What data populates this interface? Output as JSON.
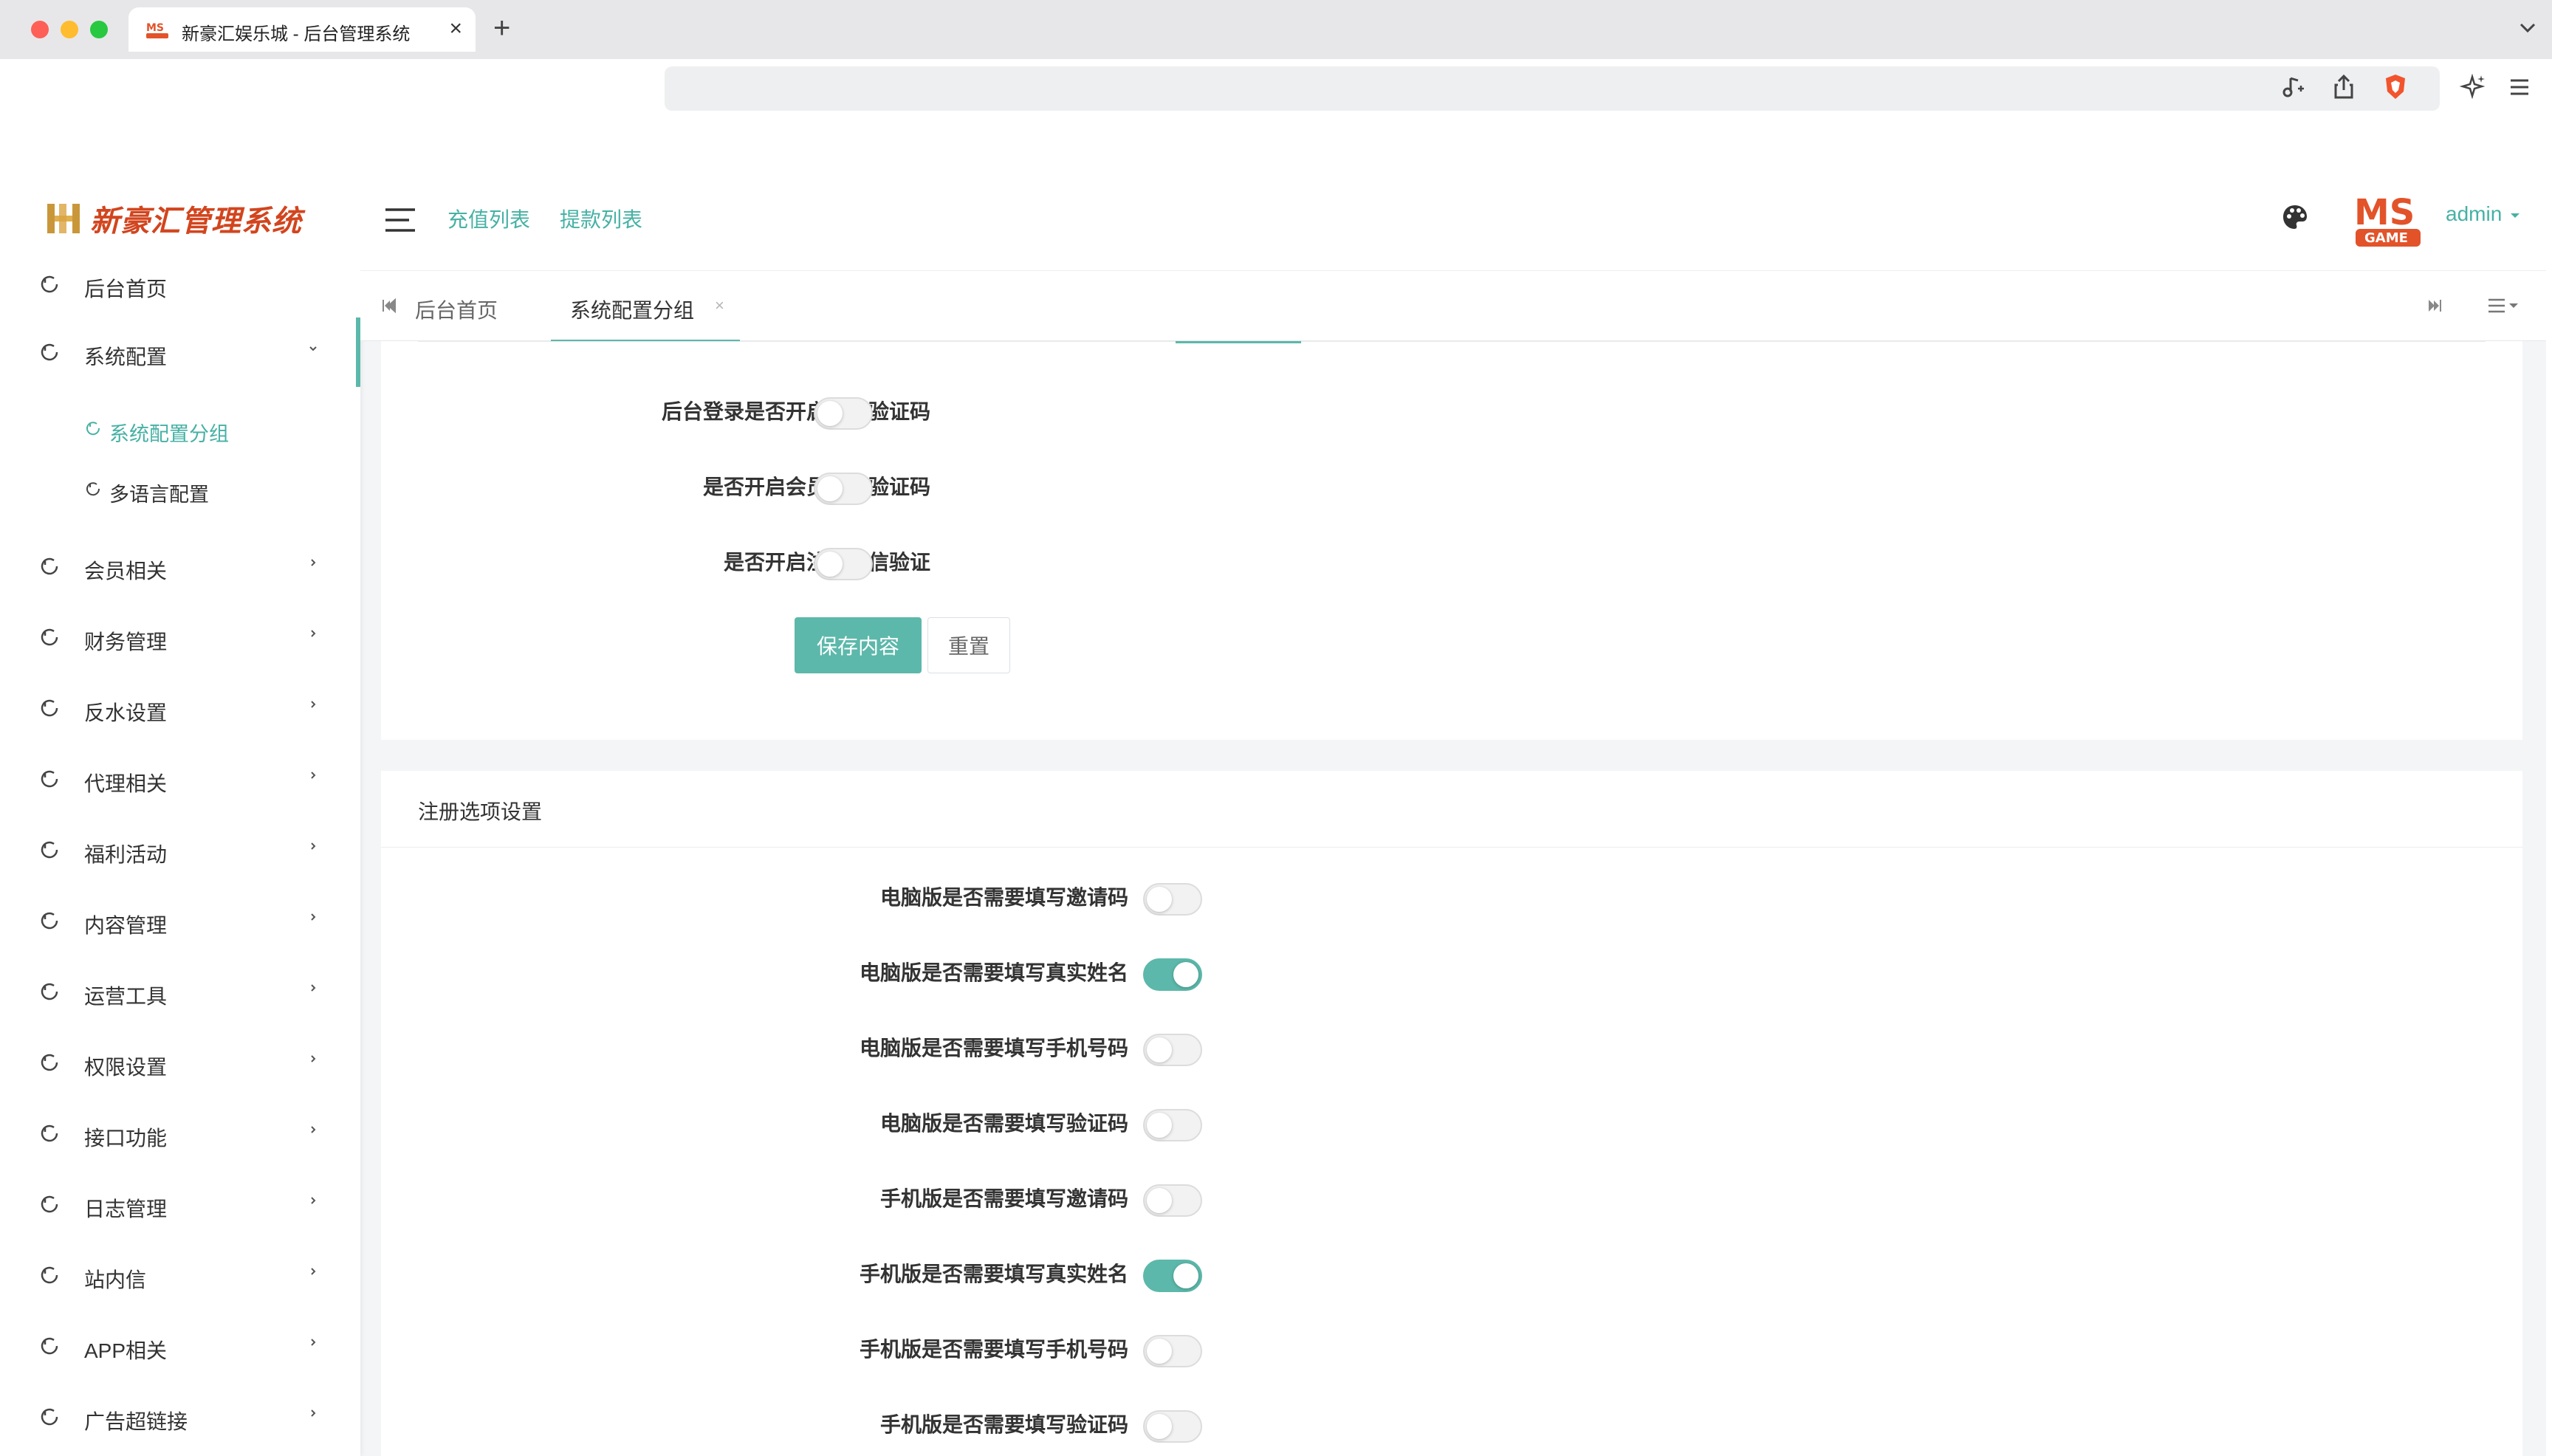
{
  "browser": {
    "tab_title": "新豪汇娱乐城 - 后台管理系统",
    "tab_close": "×",
    "new_tab": "+"
  },
  "sidebar": {
    "logo_text": "新豪汇管理系统",
    "items": [
      {
        "label": "后台首页"
      },
      {
        "label": "系统配置"
      },
      {
        "label": "会员相关"
      },
      {
        "label": "财务管理"
      },
      {
        "label": "反水设置"
      },
      {
        "label": "代理相关"
      },
      {
        "label": "福利活动"
      },
      {
        "label": "内容管理"
      },
      {
        "label": "运营工具"
      },
      {
        "label": "权限设置"
      },
      {
        "label": "接口功能"
      },
      {
        "label": "日志管理"
      },
      {
        "label": "站内信"
      },
      {
        "label": "APP相关"
      },
      {
        "label": "广告超链接"
      }
    ],
    "sub_items": [
      {
        "label": "系统配置分组",
        "active": true
      },
      {
        "label": "多语言配置",
        "active": false
      }
    ]
  },
  "header": {
    "links": [
      "充值列表",
      "提款列表"
    ],
    "user": "admin",
    "logo_text_top": "MS",
    "logo_text_bottom": "GAME"
  },
  "page_tabs": [
    {
      "label": "后台首页",
      "active": false
    },
    {
      "label": "系统配置分组",
      "active": true,
      "close": "×"
    }
  ],
  "login_section": {
    "fields": [
      {
        "label": "后台登录是否开启谷歌验证码",
        "on": false
      },
      {
        "label": "是否开启会员登录验证码",
        "on": false
      },
      {
        "label": "是否开启注册短信验证",
        "on": false
      }
    ],
    "save_label": "保存内容",
    "reset_label": "重置"
  },
  "register_section": {
    "title": "注册选项设置",
    "fields": [
      {
        "label": "电脑版是否需要填写邀请码",
        "on": false
      },
      {
        "label": "电脑版是否需要填写真实姓名",
        "on": true
      },
      {
        "label": "电脑版是否需要填写手机号码",
        "on": false
      },
      {
        "label": "电脑版是否需要填写验证码",
        "on": false
      },
      {
        "label": "手机版是否需要填写邀请码",
        "on": false
      },
      {
        "label": "手机版是否需要填写真实姓名",
        "on": true
      },
      {
        "label": "手机版是否需要填写手机号码",
        "on": false
      },
      {
        "label": "手机版是否需要填写验证码",
        "on": false
      }
    ]
  },
  "colors": {
    "accent": "#5cb8aa",
    "link": "#46b1a4",
    "logo": "#d2451e"
  }
}
